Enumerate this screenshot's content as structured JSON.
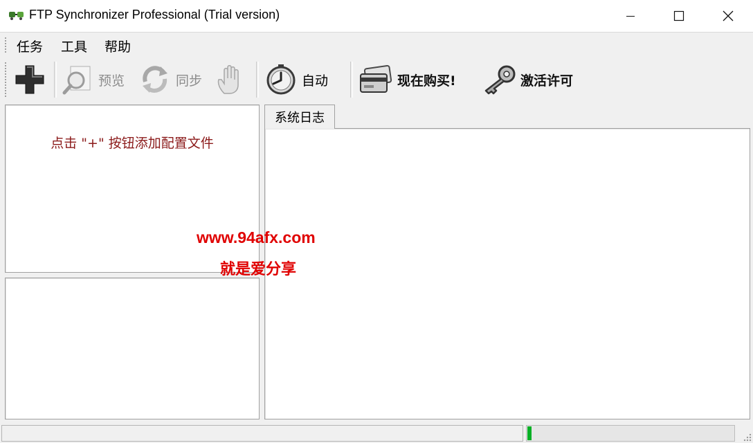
{
  "window": {
    "title": "FTP Synchronizer Professional (Trial version)",
    "controls": [
      "minimize-icon",
      "maximize-icon",
      "close-icon"
    ]
  },
  "menu": {
    "items": [
      "任务",
      "工具",
      "帮助"
    ]
  },
  "toolbar": {
    "add_icon": "plus-icon",
    "preview_label": "预览",
    "sync_label": "同步",
    "stop_icon": "hand-icon",
    "auto_label": "自动",
    "buy_label": "现在购买!",
    "activate_label": "激活许可"
  },
  "profiles": {
    "hint": "点击 \"+\" 按钮添加配置文件"
  },
  "tabs": {
    "log_label": "系统日志"
  },
  "watermark": {
    "url": "www.94afx.com",
    "text": "就是爱分享"
  },
  "status": {
    "progress": 0.02
  },
  "colors": {
    "hint": "#8b1a1a",
    "watermark": "#e00000",
    "progress": "#06b025"
  }
}
